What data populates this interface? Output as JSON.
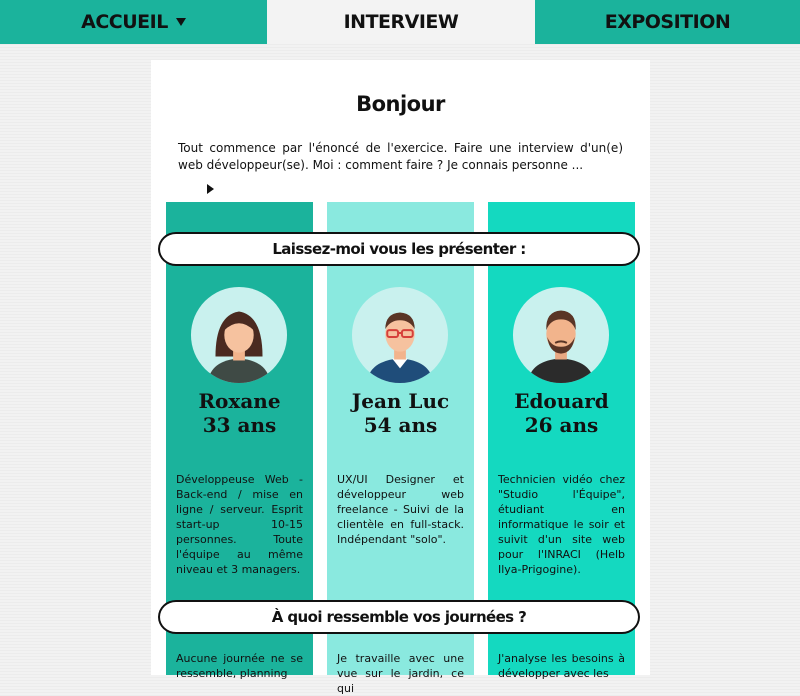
{
  "nav": {
    "items": [
      {
        "label": "ACCUEIL"
      },
      {
        "label": "INTERVIEW"
      },
      {
        "label": "EXPOSITION"
      }
    ]
  },
  "page": {
    "title": "Bonjour",
    "intro": "Tout commence par l'énoncé de l'exercice. Faire une interview d'un(e) web développeur(se). Moi : comment faire ? Je connais personne ..."
  },
  "banners": {
    "present": "Laissez-moi vous les présenter :",
    "days": "À quoi ressemble vos journées ?"
  },
  "people": [
    {
      "name": "Roxane",
      "age": "33 ans",
      "bio": "Développeuse Web - Back-end / mise en ligne / serveur. Esprit start-up 10-15 personnes. Toute l'équipe au même niveau et 3 managers.",
      "day": "Aucune journée ne se ressemble, planning"
    },
    {
      "name": "Jean Luc",
      "age": "54 ans",
      "bio": "UX/UI Designer et développeur web freelance - Suivi de la clientèle en full-stack. Indépendant \"solo\".",
      "day": "Je travaille avec une vue sur le jardin, ce qui"
    },
    {
      "name": "Edouard",
      "age": "26 ans",
      "bio": "Technicien vidéo chez \"Studio l'Équipe\", étudiant en informatique le soir et suivit d'un site web pour l'INRACI (Helb Ilya-Prigogine).",
      "day": "J'analyse les besoins à développer avec les"
    }
  ],
  "colors": {
    "nav_teal": "#1bb39c",
    "col_1": "#1bb39c",
    "col_2": "#8ae9df",
    "col_3": "#14d9c0",
    "avatar_bg": "#c9f1ee"
  },
  "icons": [
    "dropdown-caret-icon",
    "play-icon",
    "avatar-woman-icon",
    "avatar-man-glasses-icon",
    "avatar-man-beard-icon"
  ]
}
